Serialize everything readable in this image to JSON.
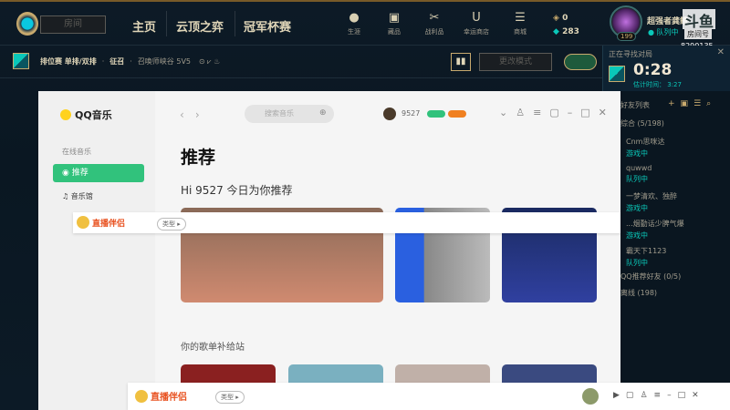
{
  "lol": {
    "room_placeholder": "房间",
    "nav": [
      "主页",
      "云顶之弈",
      "冠军杯赛"
    ],
    "top_icons": [
      {
        "icon": "profile-icon",
        "label": "生涯"
      },
      {
        "icon": "collection-icon",
        "label": "藏品"
      },
      {
        "icon": "loot-icon",
        "label": "战利品"
      },
      {
        "icon": "lucky-store-icon",
        "label": "幸运商店"
      },
      {
        "icon": "store-icon",
        "label": "商城"
      }
    ],
    "blue_essence": "0",
    "riot_points": "283",
    "player": {
      "name": "超强者龚鳢",
      "status": "队列中",
      "level": "199"
    },
    "overlay": {
      "logo": "斗鱼",
      "room_label": "房间号",
      "room_id": "8290135"
    },
    "mode": {
      "queue": "排位赛 单排/双排",
      "dot": "·",
      "phase": "征召",
      "map": "召唤师峡谷 5V5"
    },
    "change_mode": "更改模式",
    "queue": {
      "title": "正在寻找对局",
      "time": "0:28",
      "estimate": "估计时间： 3:27"
    },
    "friends": {
      "header": "好友列表",
      "group1": "综合 (5/198)",
      "list": [
        {
          "name": "Cnm思咪达",
          "status": "游戏中"
        },
        {
          "name": "quwwd",
          "status": "队列中"
        },
        {
          "name": "一梦清欢、独醉",
          "status": "游戏中"
        },
        {
          "name": "...烟勤话少脾气爆",
          "status": "游戏中"
        },
        {
          "name": "霸天下1123",
          "status": "队列中"
        }
      ],
      "group2": "QQ推荐好友 (0/5)",
      "group3": "离线 (198)"
    }
  },
  "qqmusic": {
    "logo": "QQ音乐",
    "section": "在线音乐",
    "nav_active": "推荐",
    "nav2": "音乐馆",
    "search_placeholder": "搜索音乐",
    "username": "9527",
    "title": "推荐",
    "greeting": "Hi 9527 今日为你推荐",
    "section2": "你的歌单补给站"
  },
  "livecompanion": {
    "logo": "直播伴侣",
    "type_btn": "类型 ▸"
  }
}
